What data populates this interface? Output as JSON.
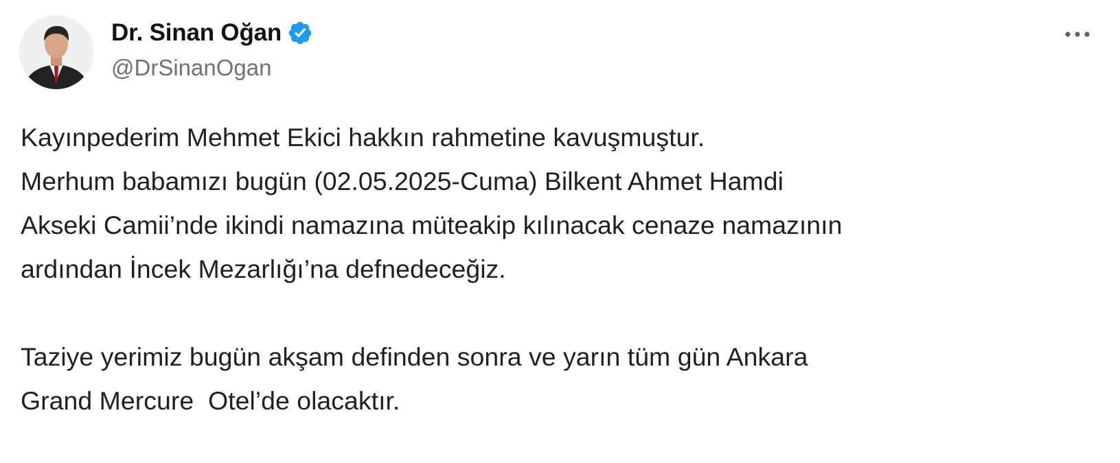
{
  "tweet": {
    "author": {
      "display_name": "Dr. Sinan Oğan",
      "handle": "@DrSinanOgan",
      "verified": true,
      "verified_color": "#1d9bf0",
      "avatar_icon": "profile-avatar"
    },
    "more_icon": "more-horizontal-icon",
    "paragraphs": [
      [
        "Kayınpederim Mehmet Ekici hakkın rahmetine kavuşmuştur.",
        "Merhum babamızı bugün (02.05.2025-Cuma) Bilkent Ahmet Hamdi",
        "Akseki Camii’nde ikindi namazına müteakip kılınacak cenaze namazının",
        "ardından İncek Mezarlığı’na defnedeceğiz."
      ],
      [
        "Taziye yerimiz bugün akşam definden sonra ve yarın tüm gün Ankara",
        "Grand Mercure  Otel’de olacaktır."
      ]
    ]
  }
}
